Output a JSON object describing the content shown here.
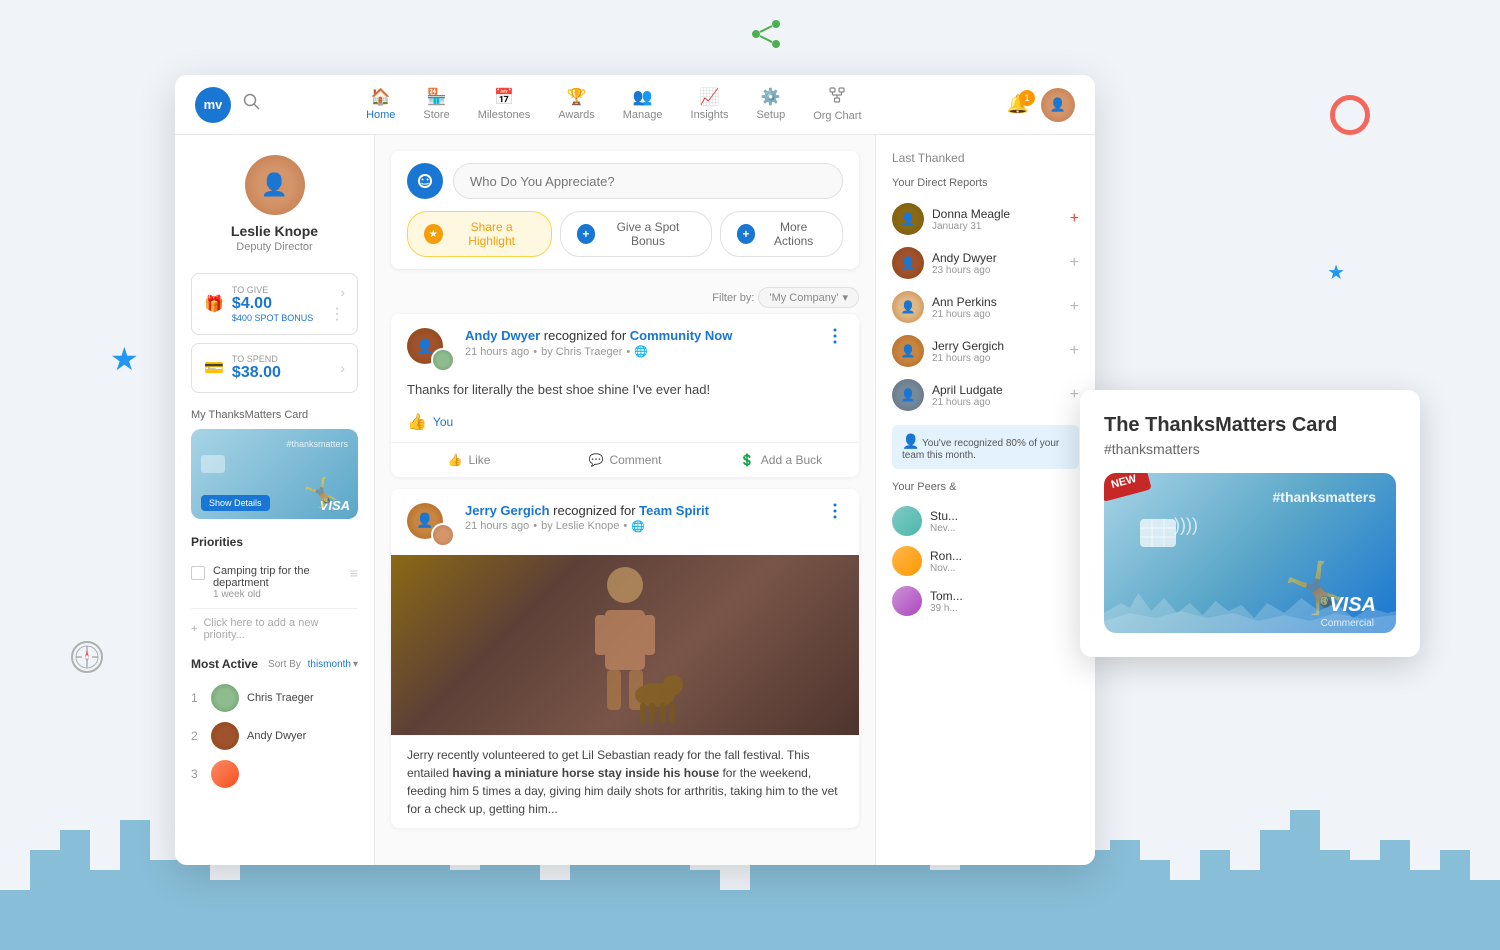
{
  "decorative": {
    "share_icon": "⟨",
    "star": "★",
    "compass": "⊘"
  },
  "nav": {
    "logo_text": "mv",
    "items": [
      {
        "id": "home",
        "label": "Home",
        "icon": "🏠",
        "active": true
      },
      {
        "id": "store",
        "label": "Store",
        "icon": "🏪",
        "active": false
      },
      {
        "id": "milestones",
        "label": "Milestones",
        "icon": "📅",
        "active": false
      },
      {
        "id": "awards",
        "label": "Awards",
        "icon": "🏆",
        "active": false
      },
      {
        "id": "manage",
        "label": "Manage",
        "icon": "👥",
        "active": false
      },
      {
        "id": "insights",
        "label": "Insights",
        "icon": "📈",
        "active": false
      },
      {
        "id": "setup",
        "label": "Setup",
        "icon": "⚙️",
        "active": false
      },
      {
        "id": "org-chart",
        "label": "Org Chart",
        "icon": "⟨",
        "active": false
      }
    ],
    "bell_count": "1"
  },
  "sidebar": {
    "profile": {
      "name": "Leslie Knope",
      "title": "Deputy Director"
    },
    "stats": {
      "to_give_label": "TO GIVE",
      "to_give_value": "$4.00",
      "to_give_sub": "$400 SPOT BONUS",
      "to_spend_label": "TO SPEND",
      "to_spend_value": "$38.00"
    },
    "card": {
      "title": "My ThanksMatters Card",
      "hashtag": "#thanksmatters",
      "show_details": "Show Details",
      "visa_label": "VISA",
      "visa_sub": "Commercial"
    },
    "priorities": {
      "title": "Priorities",
      "items": [
        {
          "text": "Camping trip for the department",
          "age": "1 week old"
        }
      ],
      "add_label": "Click here to add a new priority..."
    },
    "most_active": {
      "title": "Most Active",
      "sort_by_label": "Sort By",
      "sort_by_value": "thismonth",
      "items": [
        {
          "rank": "1",
          "name": "Chris Traeger"
        },
        {
          "rank": "2",
          "name": "Andy Dwyer"
        },
        {
          "rank": "3",
          "name": ""
        }
      ]
    }
  },
  "feed": {
    "appreciation_placeholder": "Who Do You Appreciate?",
    "buttons": {
      "highlight": "Share a Highlight",
      "spot_bonus": "Give a Spot Bonus",
      "more_actions": "More Actions"
    },
    "filter": {
      "label": "Filter by:",
      "value": "'My Company'"
    },
    "posts": [
      {
        "id": "post1",
        "author": "Andy Dwyer",
        "action": "recognized for",
        "target": "Community Now",
        "time": "21 hours ago",
        "by": "by Chris Traeger",
        "body": "Thanks for literally the best shoe shine I've ever had!",
        "likes": "You",
        "like_count": 1
      },
      {
        "id": "post2",
        "author": "Jerry Gergich",
        "action": "recognized for",
        "target": "Team Spirit",
        "time": "21 hours ago",
        "by": "by Leslie Knope",
        "has_image": true,
        "caption": "Jerry recently volunteered to get Lil Sebastian ready for the fall festival. This entailed having a miniature horse stay inside his house for the weekend, feeding him 5 times a day, giving him daily shots for arthritis, taking him to the vet for a check up, getting him..."
      }
    ],
    "post_actions": {
      "like": "Like",
      "comment": "Comment",
      "add_buck": "Add a Buck"
    }
  },
  "right_panel": {
    "last_thanked_title": "Last Thanked",
    "direct_reports_title": "Your Direct Reports",
    "direct_reports": [
      {
        "name": "Donna Meagle",
        "time": "January 31"
      },
      {
        "name": "Andy Dwyer",
        "time": "23 hours ago"
      },
      {
        "name": "Ann Perkins",
        "time": "21 hours ago"
      },
      {
        "name": "Jerry Gergich",
        "time": "21 hours ago"
      },
      {
        "name": "April Ludgate",
        "time": "21 hours ago"
      }
    ],
    "recognition_note": "You've recognized 80% of your team this month.",
    "peers_title": "Your Peers &",
    "peers": [
      {
        "name": "Stu...",
        "time": "Nev..."
      },
      {
        "name": "Ron...",
        "time": "Nov..."
      },
      {
        "name": "Tom...",
        "time": "39 h..."
      }
    ]
  },
  "thanks_card": {
    "title": "The ThanksMatters Card",
    "hashtag": "#thanksmatters",
    "new_badge": "NEW",
    "visa_label": "VISA",
    "visa_sub": "Commercial"
  }
}
